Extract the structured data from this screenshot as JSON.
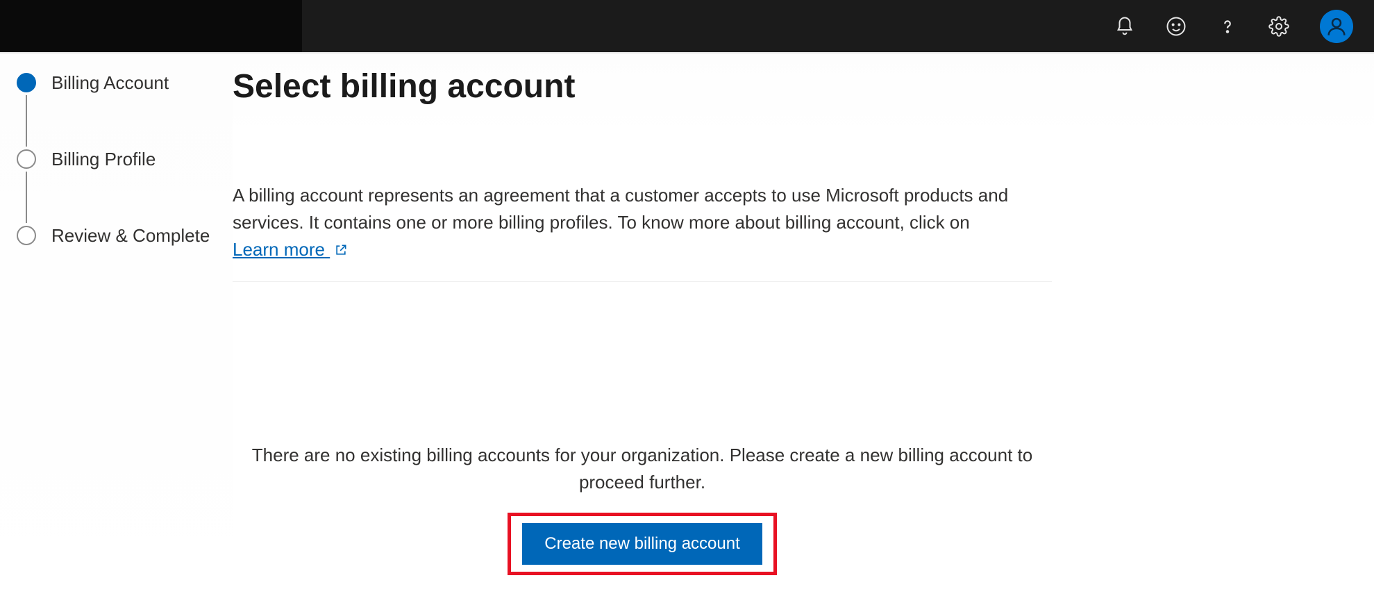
{
  "stepper": {
    "steps": [
      {
        "label": "Billing Account",
        "active": true
      },
      {
        "label": "Billing Profile",
        "active": false
      },
      {
        "label": "Review & Complete",
        "active": false
      }
    ]
  },
  "content": {
    "title": "Select billing account",
    "description_prefix": "A billing account represents an agreement that a customer accepts to use Microsoft products and services. It contains one or more billing profiles. To know more about billing account, click on ",
    "learn_more_label": "Learn more",
    "empty_message": "There are no existing billing accounts for your organization. Please create a new billing account to proceed further.",
    "create_button_label": "Create new billing account"
  }
}
